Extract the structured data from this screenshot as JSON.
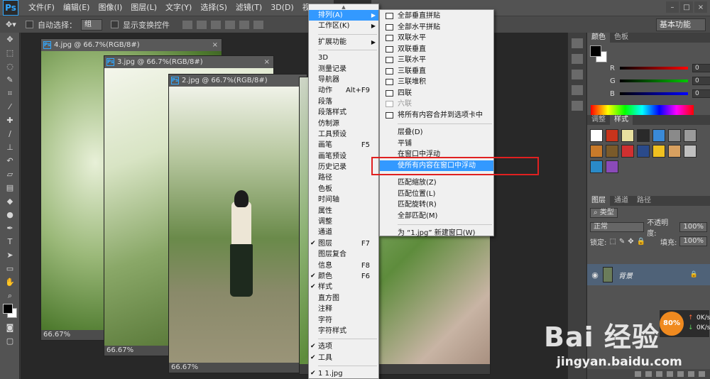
{
  "app_logo": "Ps",
  "menubar": {
    "items": [
      "文件(F)",
      "编辑(E)",
      "图像(I)",
      "图层(L)",
      "文字(Y)",
      "选择(S)",
      "滤镜(T)",
      "3D(D)",
      "视图(V)",
      "窗口(W)"
    ],
    "active_index": 9
  },
  "options": {
    "auto_select_label": "自动选择：",
    "auto_select_value": "组",
    "show_transform_label": "显示变换控件",
    "workspace": "基本功能"
  },
  "documents": [
    {
      "title": "4.jpg @ 66.7%(RGB/8#)",
      "zoom": "66.67%"
    },
    {
      "title": "3.jpg @ 66.7%(RGB/8#)",
      "zoom": "66.67%"
    },
    {
      "title": "2.jpg @ 66.7%(RGB/8#)",
      "zoom": "66.67%"
    }
  ],
  "window_menu": {
    "items": [
      {
        "label": "排列(A)",
        "arrow": true,
        "highlight": true
      },
      {
        "label": "工作区(K)",
        "arrow": true
      },
      {
        "sep": true
      },
      {
        "label": "扩展功能",
        "arrow": true
      },
      {
        "sep": true
      },
      {
        "label": "3D"
      },
      {
        "label": "测量记录"
      },
      {
        "label": "导航器"
      },
      {
        "label": "动作",
        "shortcut": "Alt+F9"
      },
      {
        "label": "段落"
      },
      {
        "label": "段落样式"
      },
      {
        "label": "仿制源"
      },
      {
        "label": "工具预设"
      },
      {
        "label": "画笔",
        "shortcut": "F5"
      },
      {
        "label": "画笔预设"
      },
      {
        "label": "历史记录"
      },
      {
        "label": "路径"
      },
      {
        "label": "色板"
      },
      {
        "label": "时间轴"
      },
      {
        "label": "属性"
      },
      {
        "label": "调整"
      },
      {
        "label": "通道"
      },
      {
        "label": "图层",
        "shortcut": "F7",
        "checked": true
      },
      {
        "label": "图层复合"
      },
      {
        "label": "信息",
        "shortcut": "F8"
      },
      {
        "label": "颜色",
        "shortcut": "F6",
        "checked": true
      },
      {
        "label": "样式",
        "checked": true
      },
      {
        "label": "直方图"
      },
      {
        "label": "注释"
      },
      {
        "label": "字符"
      },
      {
        "label": "字符样式"
      },
      {
        "sep": true
      },
      {
        "label": "选项",
        "checked": true
      },
      {
        "label": "工具",
        "checked": true
      },
      {
        "sep": true
      },
      {
        "label": "1 1.jpg",
        "checked": true
      }
    ]
  },
  "arrange_submenu": {
    "items": [
      {
        "label": "全部垂直拼贴",
        "icon": true
      },
      {
        "label": "全部水平拼贴",
        "icon": true
      },
      {
        "label": "双联水平",
        "icon": true
      },
      {
        "label": "双联垂直",
        "icon": true
      },
      {
        "label": "三联水平",
        "icon": true
      },
      {
        "label": "三联垂直",
        "icon": true
      },
      {
        "label": "三联堆积",
        "icon": true
      },
      {
        "label": "四联",
        "icon": true
      },
      {
        "label": "六联",
        "icon": true,
        "disabled": true
      },
      {
        "label": "将所有内容合并到选项卡中",
        "icon": true
      },
      {
        "sep": true
      },
      {
        "label": "层叠(D)"
      },
      {
        "label": "平铺"
      },
      {
        "label": "在窗口中浮动"
      },
      {
        "label": "使所有内容在窗口中浮动",
        "highlight": true
      },
      {
        "sep": true
      },
      {
        "label": "匹配缩放(Z)"
      },
      {
        "label": "匹配位置(L)"
      },
      {
        "label": "匹配旋转(R)"
      },
      {
        "label": "全部匹配(M)"
      },
      {
        "sep": true
      },
      {
        "label": "为 “1.jpg” 新建窗口(W)"
      }
    ]
  },
  "color_panel": {
    "tabs": [
      "颜色",
      "色板"
    ],
    "channels": [
      {
        "label": "R",
        "value": "0",
        "color": "#ff0000"
      },
      {
        "label": "G",
        "value": "0",
        "color": "#00c800"
      },
      {
        "label": "B",
        "value": "0",
        "color": "#0000ff"
      }
    ]
  },
  "styles_panel": {
    "tabs": [
      "调整",
      "样式"
    ],
    "swatch_colors": [
      "#ffffff",
      "#c8341c",
      "#e8e0a0",
      "#2a2a2a",
      "#3a8ad8",
      "#8a8a8a",
      "#9a9a9a",
      "#c87a2a",
      "#7a5a2a",
      "#d03030",
      "#2a4a8a",
      "#f0c020",
      "#d8a060",
      "#c0c0c0",
      "#2a8ac8",
      "#8a4ab8"
    ]
  },
  "layers_panel": {
    "tabs": [
      "图层",
      "通道",
      "路径"
    ],
    "kind_label": "类型",
    "blend_mode": "正常",
    "opacity_label": "不透明度:",
    "opacity_value": "100%",
    "lock_label": "锁定:",
    "fill_label": "填充:",
    "fill_value": "100%",
    "layer_name": "背景"
  },
  "net_widget": {
    "percent": "80%",
    "up": "0K/s",
    "down": "0K/s"
  },
  "watermark": {
    "brand": "Bai 经验",
    "url": "jingyan.baidu.com"
  }
}
